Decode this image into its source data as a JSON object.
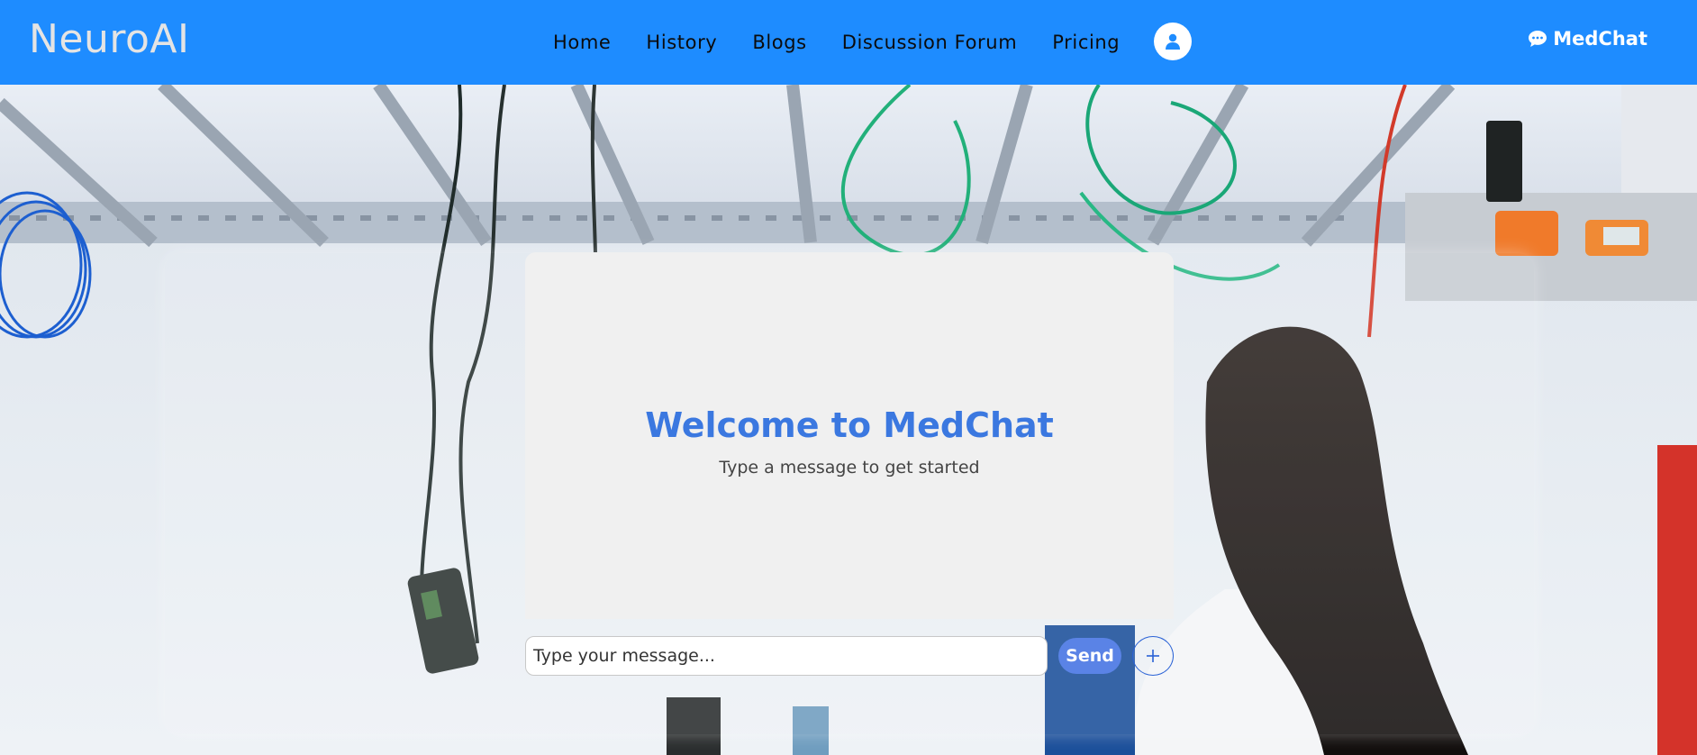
{
  "brand": {
    "name": "NeuroAI"
  },
  "nav": {
    "links": [
      {
        "label": "Home"
      },
      {
        "label": "History"
      },
      {
        "label": "Blogs"
      },
      {
        "label": "Discussion Forum"
      },
      {
        "label": "Pricing"
      }
    ],
    "avatar_icon": "user-icon",
    "medchat_label": "MedChat",
    "medchat_icon": "chat-bubble-icon"
  },
  "chat": {
    "welcome_title": "Welcome to MedChat",
    "welcome_subtitle": "Type a message to get started",
    "input_placeholder": "Type your message...",
    "input_value": "",
    "send_label": "Send",
    "add_icon": "plus-icon"
  },
  "colors": {
    "navbar": "#1e8cff",
    "title": "#3b78e0",
    "send_button": "#5a83e6"
  }
}
